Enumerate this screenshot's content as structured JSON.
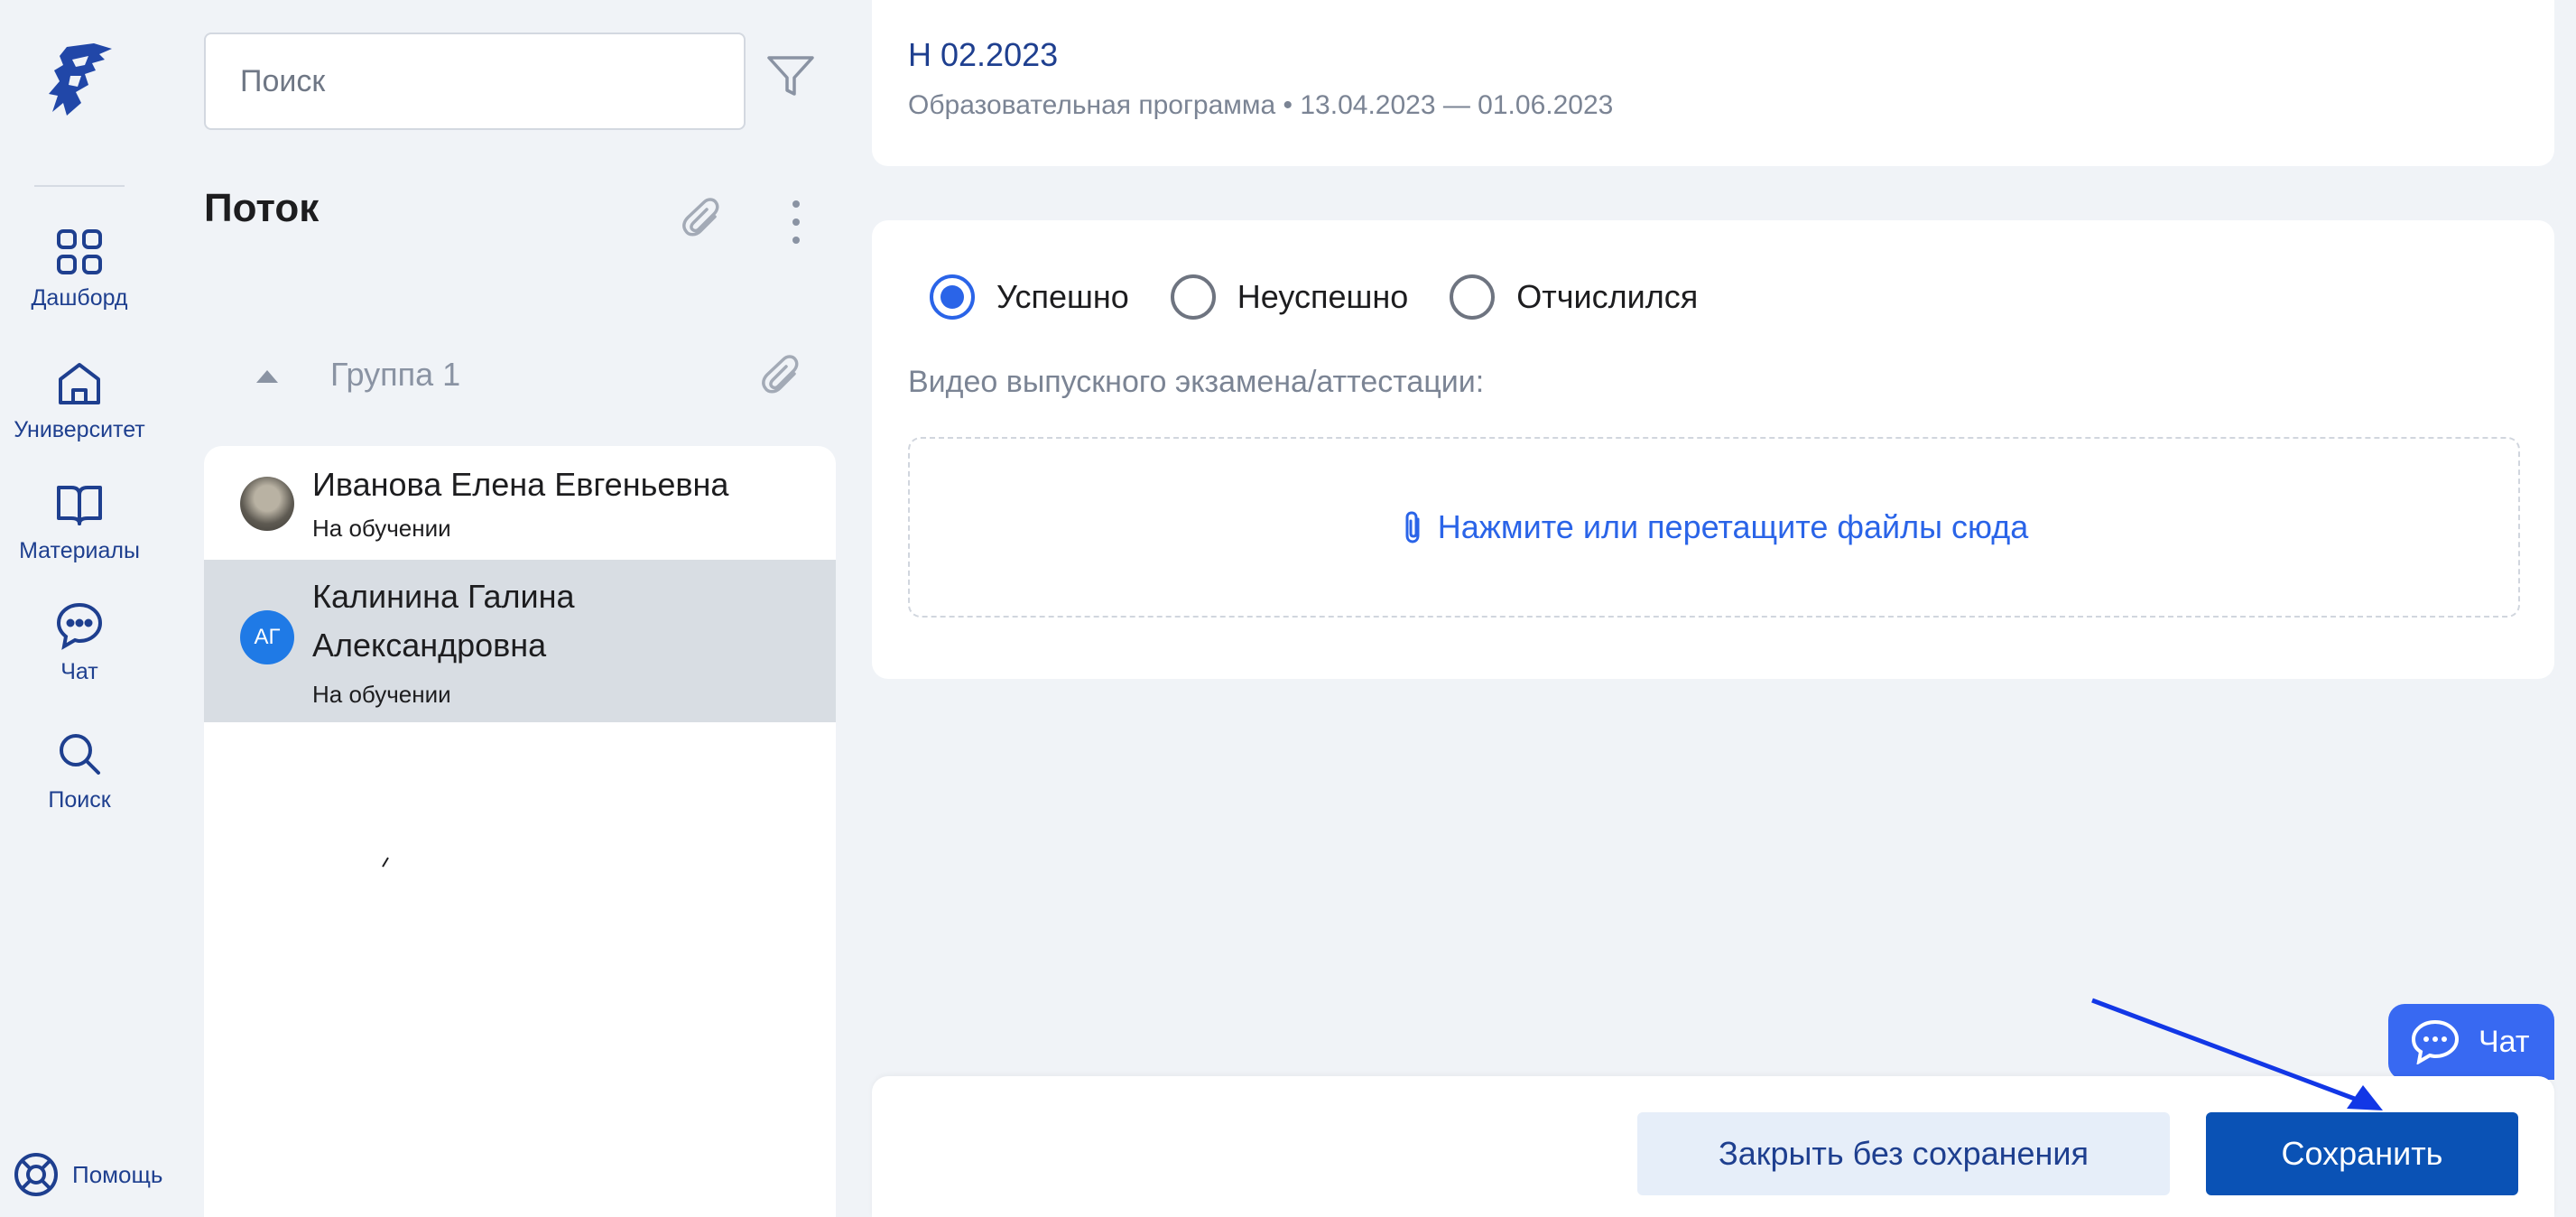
{
  "sidebar": {
    "items": [
      {
        "label": "Дашборд",
        "icon": "dashboard-grid-icon"
      },
      {
        "label": "Университет",
        "icon": "university-home-icon"
      },
      {
        "label": "Материалы",
        "icon": "book-icon"
      },
      {
        "label": "Чат",
        "icon": "chat-bubble-icon"
      },
      {
        "label": "Поиск",
        "icon": "search-icon"
      }
    ],
    "help_label": "Помощь"
  },
  "list": {
    "search_placeholder": "Поиск",
    "stream_title": "Поток",
    "group_name": "Группа 1",
    "students": [
      {
        "name": "Иванова Елена Евгеньевна",
        "status": "На обучении",
        "initials": ""
      },
      {
        "name": "Калинина Галина Александровна",
        "status": "На обучении",
        "initials": "АГ",
        "selected": true
      }
    ]
  },
  "course": {
    "title": "Н 02.2023",
    "subtitle": "Образовательная программа • 13.04.2023 — 01.06.2023"
  },
  "form": {
    "radios": [
      {
        "label": "Успешно",
        "checked": true
      },
      {
        "label": "Неуспешно",
        "checked": false
      },
      {
        "label": "Отчислился",
        "checked": false
      }
    ],
    "upload_label": "Видео выпускного экзамена/аттестации:",
    "dropzone_text": "Нажмите или перетащите файлы сюда"
  },
  "chat_widget": {
    "label": "Чат"
  },
  "footer": {
    "close_label": "Закрыть без сохранения",
    "save_label": "Сохранить"
  },
  "colors": {
    "accent": "#2a64e8",
    "primary_button": "#0a52b5",
    "nav_text": "#1e3f8f",
    "background": "#f0f3f7",
    "selected_row": "#d8dde3"
  }
}
